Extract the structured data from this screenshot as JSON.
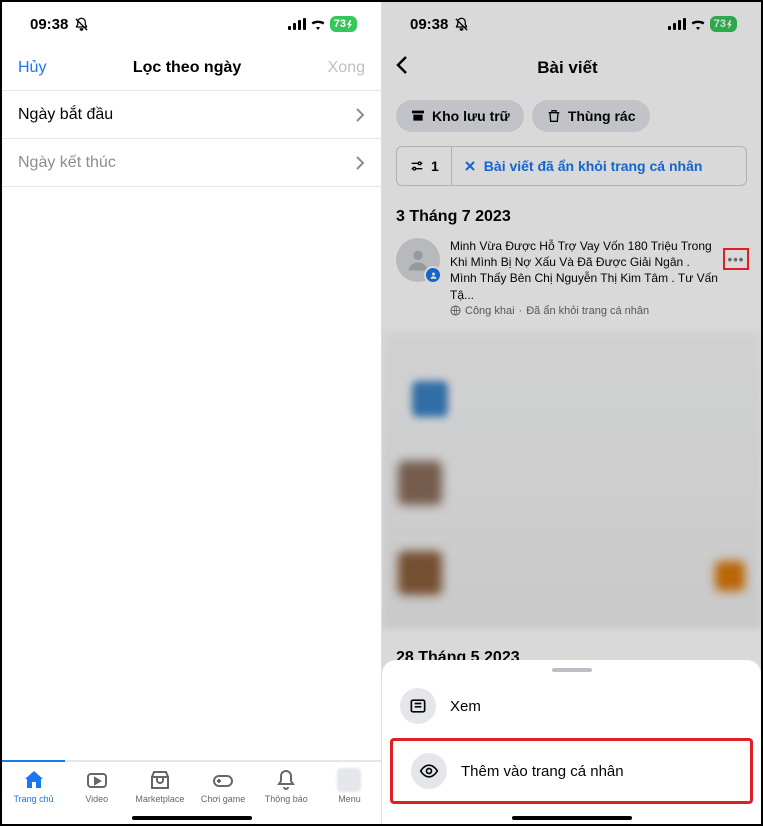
{
  "status": {
    "time": "09:38",
    "battery": "73"
  },
  "left": {
    "cancel": "Hủy",
    "title": "Lọc theo ngày",
    "done": "Xong",
    "start_date": "Ngày bắt đầu",
    "end_date": "Ngày kết thúc",
    "tabs": {
      "home": "Trang chủ",
      "video": "Video",
      "marketplace": "Marketplace",
      "gaming": "Chơi game",
      "notifications": "Thông báo",
      "menu": "Menu"
    }
  },
  "right": {
    "title": "Bài viết",
    "archive": "Kho lưu trữ",
    "trash": "Thùng rác",
    "filter_count": "1",
    "filter_label": "Bài viết đã ẩn khỏi trang cá nhân",
    "section1_date": "3 Tháng 7 2023",
    "post1_text": "Minh Vừa Được Hỗ Trợ Vay Vốn 180 Triệu Trong Khi Mình Bị Nợ Xấu Và Đã Được Giải Ngân . Mình Thấy Bên Chị  Nguyễn Thị Kim Tâm . Tư Vấn Tậ...",
    "post1_privacy": "Công khai",
    "post1_status": "Đã ẩn khỏi trang cá nhân",
    "section2_date": "28 Tháng 5 2023",
    "sheet": {
      "view": "Xem",
      "add": "Thêm vào trang cá nhân"
    }
  }
}
